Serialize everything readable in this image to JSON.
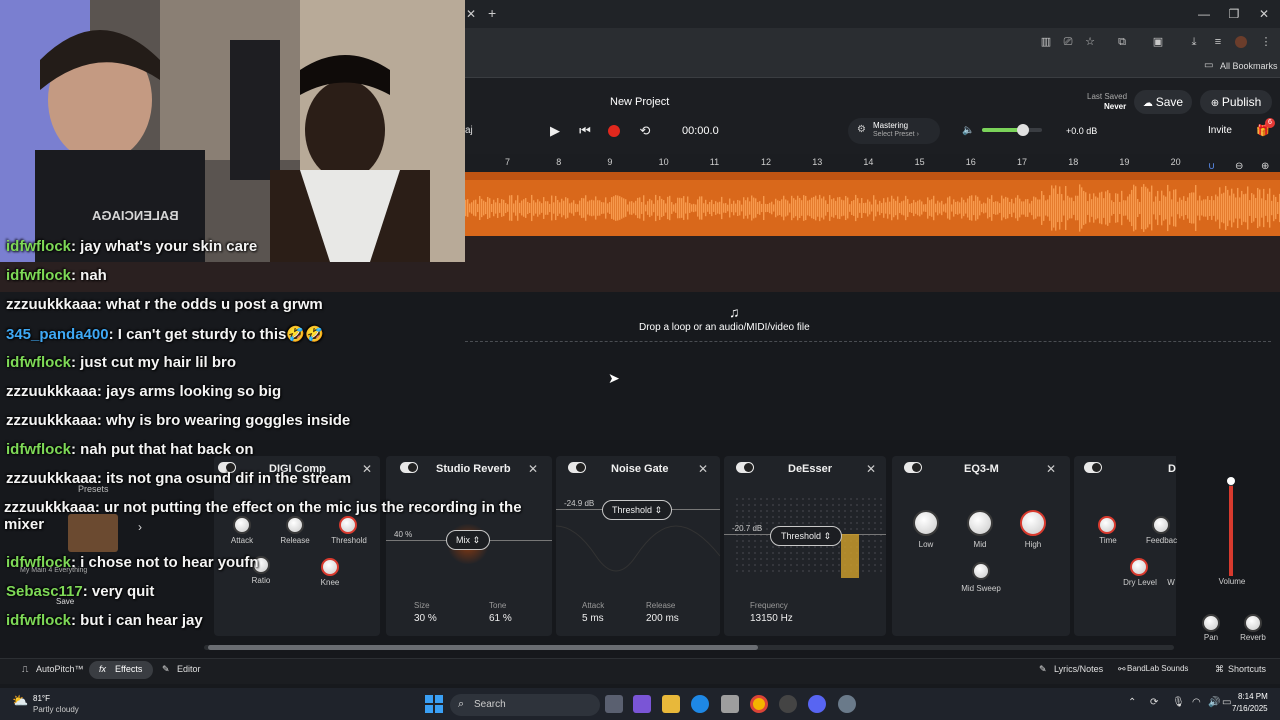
{
  "browser": {
    "new_tab": "+",
    "bookmarks_label": "All Bookmarks"
  },
  "app": {
    "project_title": "New Project",
    "last_saved_label": "Last Saved",
    "last_saved_value": "Never",
    "save_label": "Save",
    "publish_label": "Publish",
    "invite_label": "Invite",
    "invite_badge": "6",
    "time": "00:00.0",
    "mastering_title": "Mastering",
    "mastering_sub": "Select Preset ›",
    "volume_db": "+0.0 dB",
    "track_partial": "aj",
    "master_volume_fraction": 0.68,
    "accent": "#d9681b"
  },
  "timeline": {
    "ticks": [
      "7",
      "8",
      "9",
      "10",
      "11",
      "12",
      "13",
      "14",
      "15",
      "16",
      "17",
      "18",
      "19",
      "20"
    ],
    "drop_text": "Drop a loop or an audio/MIDI/video file"
  },
  "effects": {
    "presets_label": "Presets",
    "preset_name": "My Main 4 Everything",
    "save_label": "Save",
    "digi": {
      "title": "DIGI Comp",
      "attack": "Attack",
      "release": "Release",
      "threshold": "Threshold",
      "ratio": "Ratio",
      "knee": "Knee"
    },
    "reverb": {
      "title": "Studio Reverb",
      "mix_pct": "40 %",
      "mix": "Mix",
      "size_label": "Size",
      "size_val": "30 %",
      "tone_label": "Tone",
      "tone_val": "61 %"
    },
    "gate": {
      "title": "Noise Gate",
      "db": "-24.9 dB",
      "threshold": "Threshold",
      "attack_label": "Attack",
      "attack_val": "5 ms",
      "release_label": "Release",
      "release_val": "200 ms"
    },
    "deesser": {
      "title": "DeEsser",
      "db": "-20.7 dB",
      "threshold": "Threshold",
      "freq_label": "Frequency",
      "freq_val": "13150 Hz"
    },
    "eq": {
      "title": "EQ3-M",
      "low": "Low",
      "mid": "Mid",
      "high": "High",
      "sweep": "Mid Sweep"
    },
    "delay": {
      "title": "D",
      "time": "Time",
      "feedback": "Feedbac",
      "dry": "Dry Level",
      "w": "W"
    },
    "master": {
      "volume": "Volume",
      "pan": "Pan",
      "reverb": "Reverb"
    }
  },
  "bottom": {
    "autopitch": "AutoPitch™",
    "effects": "Effects",
    "editor": "Editor",
    "lyrics": "Lyrics/Notes",
    "sounds": "BandLab Sounds",
    "shortcuts": "Shortcuts"
  },
  "taskbar": {
    "temp": "81°F",
    "weather": "Partly cloudy",
    "search": "Search",
    "time": "8:14 PM",
    "date": "7/16/2025"
  },
  "webcam": {
    "shirt_text": "BALENCIAGA"
  },
  "chat": [
    {
      "user": "idfwflock",
      "msg": ": jay what's your skin care",
      "color": "green"
    },
    {
      "user": "idfwflock",
      "msg": ": nah",
      "color": "green"
    },
    {
      "user": "zzzuukkkaaa",
      "msg": ": what r the odds u post a grwm",
      "color": "white"
    },
    {
      "user": "345_panda400",
      "msg": ": I can't get sturdy to this🤣🤣",
      "color": "blue"
    },
    {
      "user": "idfwflock",
      "msg": ": just cut my hair lil bro",
      "color": "green"
    },
    {
      "user": "zzzuukkkaaa",
      "msg": ": jays arms looking so big",
      "color": "white"
    },
    {
      "user": "zzzuukkkaaa",
      "msg": ": why is bro wearing goggles inside",
      "color": "white"
    },
    {
      "user": "idfwflock",
      "msg": ": nah put that hat back on",
      "color": "green"
    },
    {
      "user": "zzzuukkkaaa",
      "msg": ": its not gna osund dif in the stream",
      "color": "white"
    },
    {
      "user": "zzzuukkkaaa",
      "msg": ": ur not putting the effect on the mic jus the recording in the mixer",
      "color": "white"
    },
    {
      "user": "idfwflock",
      "msg": ": i chose not to hear youfn",
      "color": "green"
    },
    {
      "user": "Sebasc117",
      "msg": ": very quit",
      "color": "green"
    },
    {
      "user": "idfwflock",
      "msg": ": but i can hear jay",
      "color": "green"
    }
  ]
}
